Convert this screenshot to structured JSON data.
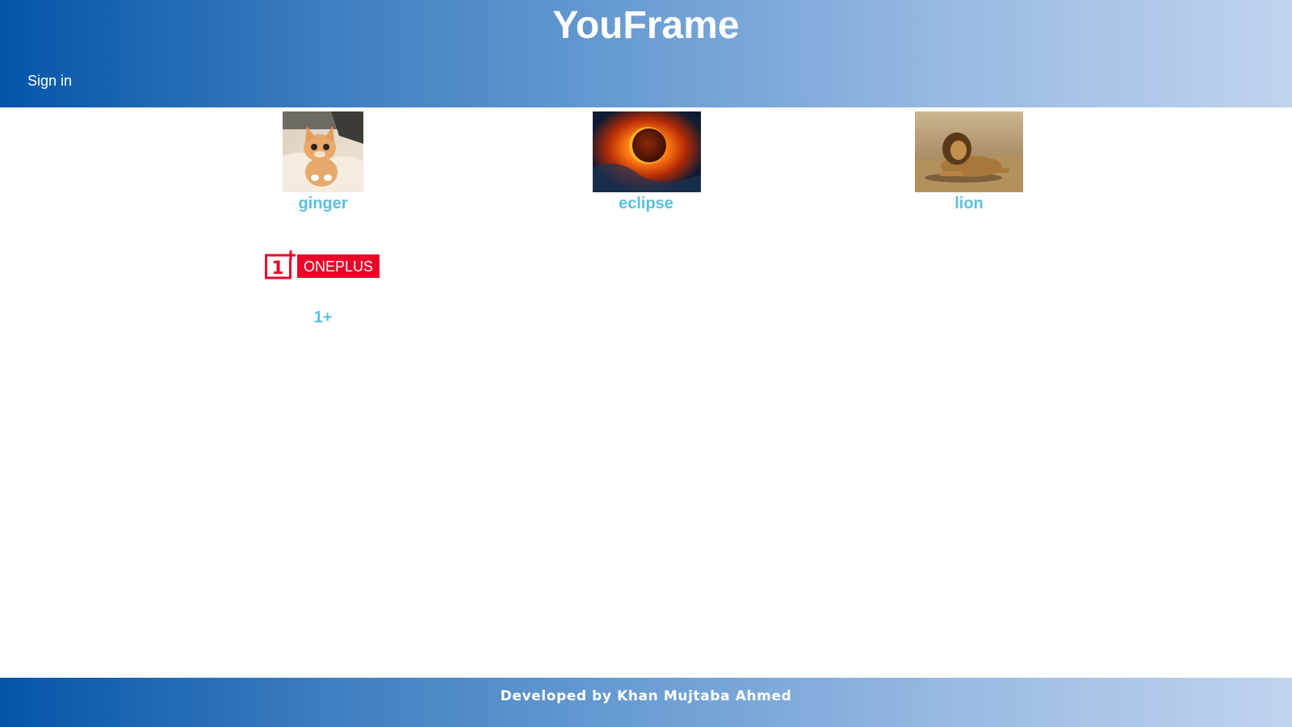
{
  "header": {
    "title": "YouFrame",
    "signin_label": "Sign in"
  },
  "gallery": [
    {
      "caption": "ginger",
      "image": "orange-kitten-photo"
    },
    {
      "caption": "eclipse",
      "image": "solar-eclipse-photo"
    },
    {
      "caption": "lion",
      "image": "lion-savanna-photo"
    },
    {
      "caption": "1+",
      "image": "oneplus-logo",
      "logo_text": "ONEPLUS"
    }
  ],
  "footer": {
    "credit": "Developed by Khan Mujtaba Ahmed"
  },
  "colors": {
    "header_gradient_start": "#0455a8",
    "header_gradient_end": "#c0d4ef",
    "caption": "#5bc0de",
    "oneplus_red": "#eb0028"
  }
}
